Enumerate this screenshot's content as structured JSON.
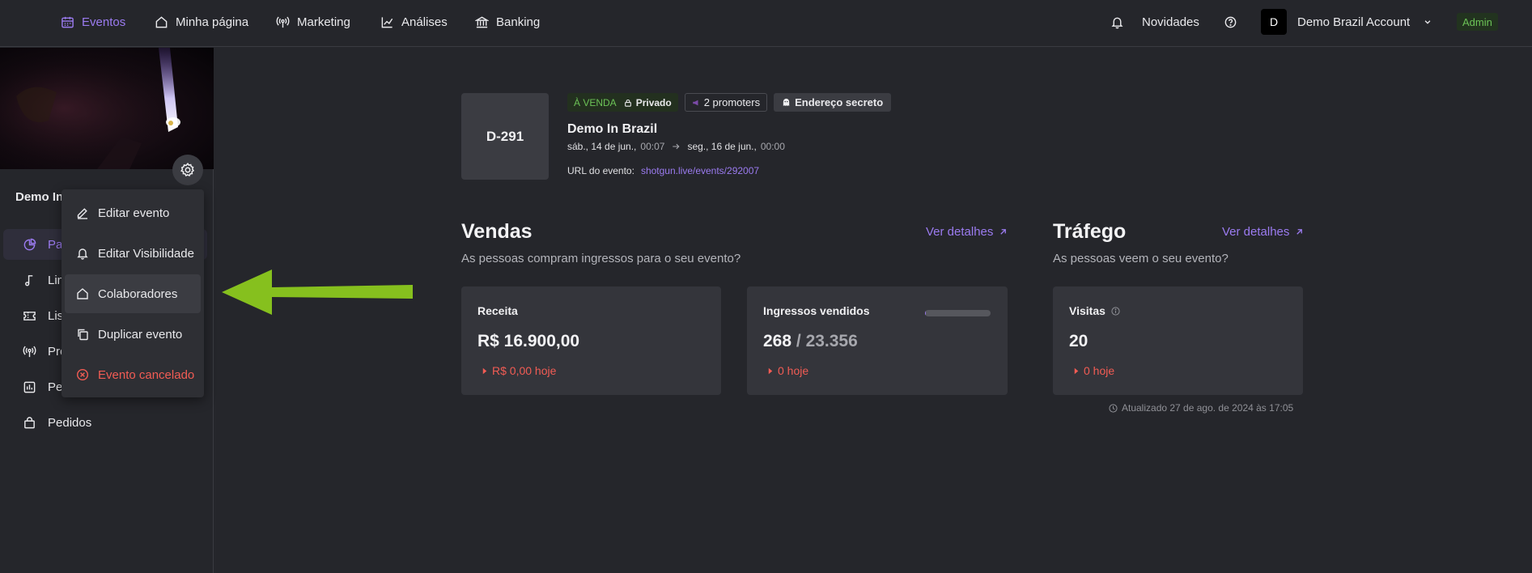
{
  "nav": {
    "items": [
      {
        "label": "Eventos",
        "icon": "calendar-icon",
        "active": true
      },
      {
        "label": "Minha página",
        "icon": "home-icon"
      },
      {
        "label": "Marketing",
        "icon": "broadcast-icon"
      },
      {
        "label": "Análises",
        "icon": "chart-line-icon"
      },
      {
        "label": "Banking",
        "icon": "bank-icon"
      }
    ],
    "news_label": "Novidades",
    "account_initial": "D",
    "account_name": "Demo Brazil Account",
    "role_badge": "Admin"
  },
  "sidebar": {
    "event_name": "Demo In",
    "items": [
      {
        "label": "Pai",
        "icon": "pie-chart-icon",
        "active": true
      },
      {
        "label": "Line",
        "icon": "music-note-icon"
      },
      {
        "label": "List",
        "icon": "ticket-icon"
      },
      {
        "label": "Pro",
        "icon": "broadcast-icon"
      },
      {
        "label": "Pes",
        "icon": "survey-icon"
      },
      {
        "label": "Pedidos",
        "icon": "bag-icon"
      }
    ]
  },
  "menu": {
    "items": [
      {
        "label": "Editar evento",
        "icon": "pencil-icon"
      },
      {
        "label": "Editar Visibilidade",
        "icon": "bell-icon"
      },
      {
        "label": "Colaboradores",
        "icon": "home-icon",
        "hover": true
      },
      {
        "label": "Duplicar evento",
        "icon": "copy-icon"
      },
      {
        "label": "Evento cancelado",
        "icon": "cancel-circle-icon",
        "danger": true
      }
    ]
  },
  "event": {
    "code": "D-291",
    "status": "À VENDA",
    "privacy": "Privado",
    "promoters": "2 promoters",
    "secret_address": "Endereço secreto",
    "title": "Demo In Brazil",
    "start_date": "sáb., 14 de jun.,",
    "start_time": "00:07",
    "end_date": "seg., 16 de jun.,",
    "end_time": "00:00",
    "url_label": "URL do evento:",
    "url": "shotgun.live/events/292007"
  },
  "sales": {
    "title": "Vendas",
    "subtitle": "As pessoas compram ingressos para o seu evento?",
    "details_label": "Ver detalhes",
    "revenue": {
      "label": "Receita",
      "value": "R$ 16.900,00",
      "today": "R$ 0,00 hoje"
    },
    "tickets": {
      "label": "Ingressos vendidos",
      "sold": "268",
      "separator": " / ",
      "total": "23.356",
      "today": "0 hoje",
      "progress_fraction": 0.0115
    }
  },
  "traffic": {
    "title": "Tráfego",
    "subtitle": "As pessoas veem o seu evento?",
    "details_label": "Ver detalhes",
    "visits": {
      "label": "Visitas",
      "value": "20",
      "today": "0 hoje"
    }
  },
  "updated_text": "Atualizado 27 de ago. de 2024 às 17:05",
  "colors": {
    "accent": "#9b7bf0",
    "background": "#25262b",
    "card": "#34353b",
    "danger": "#f25c54",
    "success": "#6cc357",
    "annotation_arrow": "#86c01e"
  }
}
